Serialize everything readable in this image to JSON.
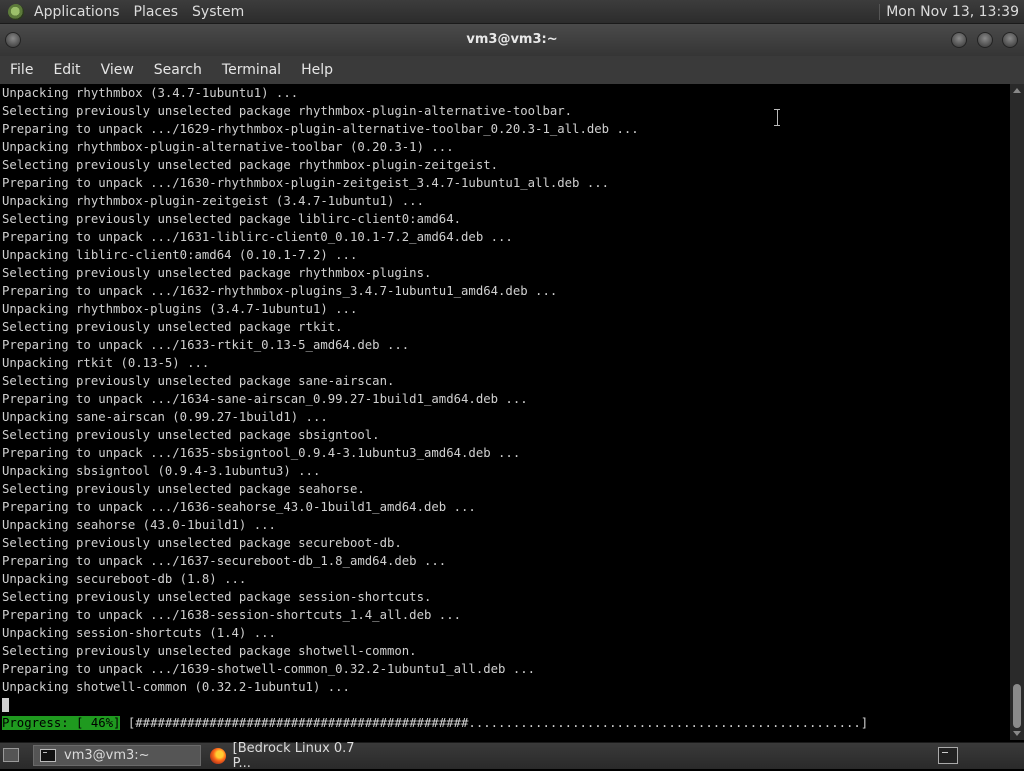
{
  "top_panel": {
    "menus": [
      "Applications",
      "Places",
      "System"
    ],
    "clock": "Mon Nov 13, 13:39"
  },
  "window": {
    "title": "vm3@vm3:~"
  },
  "menubar": [
    "File",
    "Edit",
    "View",
    "Search",
    "Terminal",
    "Help"
  ],
  "terminal": {
    "lines": [
      "Unpacking rhythmbox (3.4.7-1ubuntu1) ...",
      "Selecting previously unselected package rhythmbox-plugin-alternative-toolbar.",
      "Preparing to unpack .../1629-rhythmbox-plugin-alternative-toolbar_0.20.3-1_all.deb ...",
      "Unpacking rhythmbox-plugin-alternative-toolbar (0.20.3-1) ...",
      "Selecting previously unselected package rhythmbox-plugin-zeitgeist.",
      "Preparing to unpack .../1630-rhythmbox-plugin-zeitgeist_3.4.7-1ubuntu1_all.deb ...",
      "Unpacking rhythmbox-plugin-zeitgeist (3.4.7-1ubuntu1) ...",
      "Selecting previously unselected package liblirc-client0:amd64.",
      "Preparing to unpack .../1631-liblirc-client0_0.10.1-7.2_amd64.deb ...",
      "Unpacking liblirc-client0:amd64 (0.10.1-7.2) ...",
      "Selecting previously unselected package rhythmbox-plugins.",
      "Preparing to unpack .../1632-rhythmbox-plugins_3.4.7-1ubuntu1_amd64.deb ...",
      "Unpacking rhythmbox-plugins (3.4.7-1ubuntu1) ...",
      "Selecting previously unselected package rtkit.",
      "Preparing to unpack .../1633-rtkit_0.13-5_amd64.deb ...",
      "Unpacking rtkit (0.13-5) ...",
      "Selecting previously unselected package sane-airscan.",
      "Preparing to unpack .../1634-sane-airscan_0.99.27-1build1_amd64.deb ...",
      "Unpacking sane-airscan (0.99.27-1build1) ...",
      "Selecting previously unselected package sbsigntool.",
      "Preparing to unpack .../1635-sbsigntool_0.9.4-3.1ubuntu3_amd64.deb ...",
      "Unpacking sbsigntool (0.9.4-3.1ubuntu3) ...",
      "Selecting previously unselected package seahorse.",
      "Preparing to unpack .../1636-seahorse_43.0-1build1_amd64.deb ...",
      "Unpacking seahorse (43.0-1build1) ...",
      "Selecting previously unselected package secureboot-db.",
      "Preparing to unpack .../1637-secureboot-db_1.8_amd64.deb ...",
      "Unpacking secureboot-db (1.8) ...",
      "Selecting previously unselected package session-shortcuts.",
      "Preparing to unpack .../1638-session-shortcuts_1.4_all.deb ...",
      "Unpacking session-shortcuts (1.4) ...",
      "Selecting previously unselected package shotwell-common.",
      "Preparing to unpack .../1639-shotwell-common_0.32.2-1ubuntu1_all.deb ...",
      "Unpacking shotwell-common (0.32.2-1ubuntu1) ..."
    ],
    "progress_label": "Progress: [ 46%]",
    "progress_bar": " [#############################################.....................................................]",
    "progress_percent": 46
  },
  "taskbar": {
    "items": [
      "vm3@vm3:~",
      "[Bedrock Linux 0.7 P..."
    ]
  }
}
